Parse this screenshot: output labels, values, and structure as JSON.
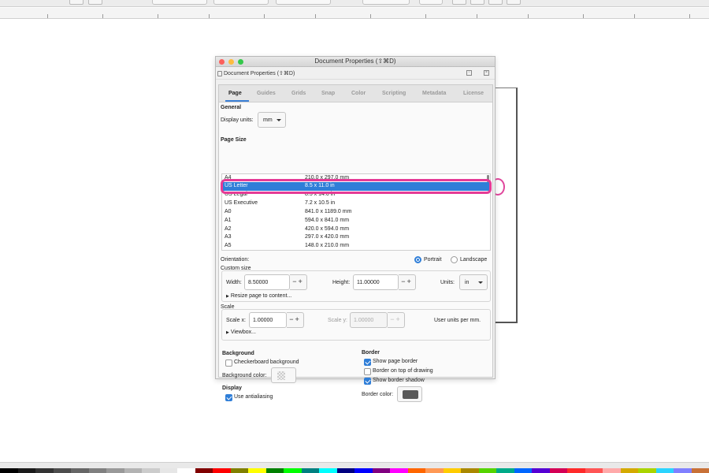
{
  "colors": {
    "accent": "#2f7ed8",
    "highlight": "#e53b96",
    "border_color_swatch": "#5a5a5a",
    "palette": [
      "#000000",
      "#1a1a1a",
      "#333333",
      "#4d4d4d",
      "#666666",
      "#808080",
      "#999999",
      "#b3b3b3",
      "#cccccc",
      "#e6e6e6",
      "#ffffff",
      "#800000",
      "#ff0000",
      "#808000",
      "#ffff00",
      "#008000",
      "#00ff00",
      "#008080",
      "#00ffff",
      "#000080",
      "#0000ff",
      "#800080",
      "#ff00ff",
      "#ff6600",
      "#ff9955",
      "#ffcc00",
      "#aa8800",
      "#55d400",
      "#00aa88",
      "#0066ff",
      "#5500d4",
      "#d40055",
      "#ff2a2a",
      "#ff5555",
      "#ffaaaa",
      "#d4aa00",
      "#aad400",
      "#2ad4ff",
      "#8080ff",
      "#c87137"
    ]
  },
  "dialog": {
    "title": "Document Properties (⇧⌘D)",
    "subtitle": "Document Properties (⇧⌘D)",
    "tabs": [
      "Page",
      "Guides",
      "Grids",
      "Snap",
      "Color",
      "Scripting",
      "Metadata",
      "License"
    ],
    "active_tab": "Page",
    "general": {
      "heading": "General",
      "display_units_label": "Display units:",
      "display_units_value": "mm"
    },
    "page_size": {
      "heading": "Page Size",
      "rows": [
        {
          "name": "A4",
          "size": "210.0 x 297.0 mm"
        },
        {
          "name": "US Letter",
          "size": "8.5 x 11.0 in"
        },
        {
          "name": "US Legal",
          "size": "8.5 x 14.0 in"
        },
        {
          "name": "US Executive",
          "size": "7.2 x 10.5 in"
        },
        {
          "name": "A0",
          "size": "841.0 x 1189.0 mm"
        },
        {
          "name": "A1",
          "size": "594.0 x 841.0 mm"
        },
        {
          "name": "A2",
          "size": "420.0 x 594.0 mm"
        },
        {
          "name": "A3",
          "size": "297.0 x 420.0 mm"
        },
        {
          "name": "A5",
          "size": "148.0 x 210.0 mm"
        }
      ],
      "selected": "US Letter"
    },
    "orientation": {
      "label": "Orientation:",
      "portrait": "Portrait",
      "landscape": "Landscape",
      "selected": "Portrait"
    },
    "custom_size": {
      "heading": "Custom size",
      "width_label": "Width:",
      "width_value": "8.50000",
      "height_label": "Height:",
      "height_value": "11.00000",
      "units_label": "Units:",
      "units_value": "in",
      "resize_label": "Resize page to content..."
    },
    "scale": {
      "heading": "Scale",
      "scale_x_label": "Scale x:",
      "scale_x_value": "1.00000",
      "scale_y_label": "Scale y:",
      "scale_y_value": "1.00000",
      "user_units": "User units per mm.",
      "viewbox_label": "Viewbox..."
    },
    "background": {
      "heading": "Background",
      "checkerboard_label": "Checkerboard background",
      "checkerboard_checked": false,
      "bg_color_label": "Background color:"
    },
    "display": {
      "heading": "Display",
      "antialias_label": "Use antialiasing",
      "antialias_checked": true
    },
    "border": {
      "heading": "Border",
      "show_border_label": "Show page border",
      "show_border_checked": true,
      "on_top_label": "Border on top of drawing",
      "on_top_checked": false,
      "shadow_label": "Show border shadow",
      "shadow_checked": true,
      "border_color_label": "Border color:"
    }
  }
}
